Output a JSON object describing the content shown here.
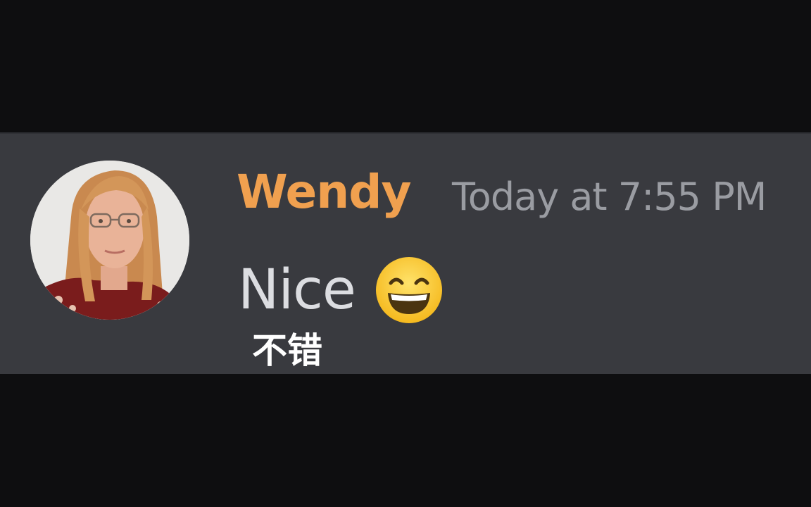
{
  "message": {
    "author": "Wendy",
    "timestamp": "Today at 7:55 PM",
    "text": "Nice",
    "emoji": "grinning-face-with-smiling-eyes-icon"
  },
  "subtitle": "不错",
  "colors": {
    "background": "#0e0e10",
    "message_bg": "#393a3f",
    "author": "#f0a04f",
    "timestamp": "#9a9ca2",
    "text": "#dcdde1",
    "subtitle": "#ffffff"
  }
}
